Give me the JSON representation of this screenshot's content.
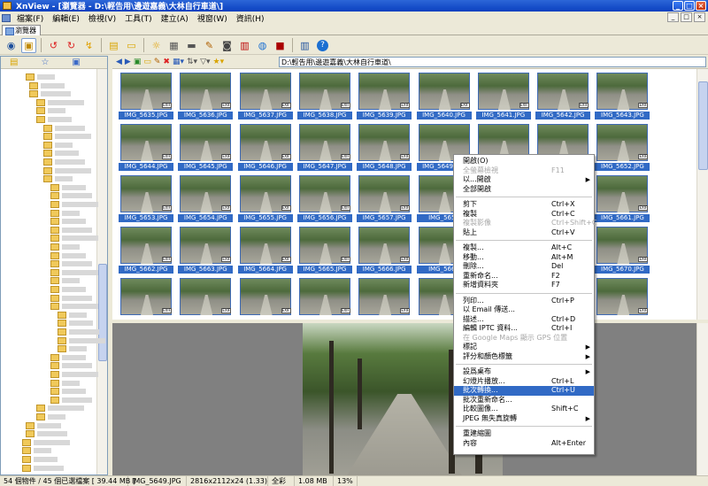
{
  "window": {
    "title": "XnView - [瀏覽器 - D:\\輕告用\\邊遊嘉義\\大林自行車道\\]",
    "buttons": [
      "_",
      "□",
      "×"
    ]
  },
  "menubar": {
    "items": [
      "檔案(F)",
      "編輯(E)",
      "檢視(V)",
      "工具(T)",
      "建立(A)",
      "視窗(W)",
      "資訊(H)"
    ]
  },
  "tabs": [
    {
      "label": "瀏覽器"
    }
  ],
  "toolbar": {
    "icons": [
      "eye-icon",
      "browser-icon",
      "rotate-left-icon",
      "rotate-right-icon",
      "refresh-icon",
      "open-icon",
      "folder-icon",
      "sun-icon",
      "print-icon",
      "scanner-icon",
      "edit-icon",
      "camera-icon",
      "filmstrip-icon",
      "web-icon",
      "stop-icon",
      "list-icon",
      "help-icon"
    ]
  },
  "address": {
    "path": "D:\\輕告用\\邊遊嘉義\\大林自行車道\\"
  },
  "thumbnails": [
    "IMG_5635.JPG",
    "IMG_5636.JPG",
    "IMG_5637.JPG",
    "IMG_5638.JPG",
    "IMG_5639.JPG",
    "IMG_5640.JPG",
    "IMG_5641.JPG",
    "IMG_5642.JPG",
    "IMG_5643.JPG",
    "IMG_5644.JPG",
    "IMG_5645.JPG",
    "IMG_5646.JPG",
    "IMG_5647.JPG",
    "IMG_5648.JPG",
    "IMG_5649.JPG",
    "",
    "",
    "IMG_5652.JPG",
    "IMG_5653.JPG",
    "IMG_5654.JPG",
    "IMG_5655.JPG",
    "IMG_5656.JPG",
    "IMG_5657.JPG",
    "IMG_5658",
    "",
    "",
    "IMG_5661.JPG",
    "IMG_5662.JPG",
    "IMG_5663.JPG",
    "IMG_5664.JPG",
    "IMG_5665.JPG",
    "IMG_5666.JPG",
    "IMG_5667",
    "",
    "",
    "IMG_5670.JPG",
    "",
    "",
    "",
    "",
    "",
    "",
    "",
    "",
    ""
  ],
  "exif_badge": "EXIF",
  "context_menu": [
    {
      "label": "開啟(O)",
      "shortcut": ""
    },
    {
      "label": "全螢幕檢視",
      "shortcut": "F11",
      "disabled": true
    },
    {
      "label": "以...開啟",
      "shortcut": "",
      "submenu": true
    },
    {
      "label": "全部開啟",
      "shortcut": ""
    },
    {
      "sep": true
    },
    {
      "label": "剪下",
      "shortcut": "Ctrl+X"
    },
    {
      "label": "複製",
      "shortcut": "Ctrl+C"
    },
    {
      "label": "複製影像",
      "shortcut": "Ctrl+Shift+C",
      "disabled": true
    },
    {
      "label": "貼上",
      "shortcut": "Ctrl+V"
    },
    {
      "sep": true
    },
    {
      "label": "複製...",
      "shortcut": "Alt+C"
    },
    {
      "label": "移動...",
      "shortcut": "Alt+M"
    },
    {
      "label": "刪除...",
      "shortcut": "Del"
    },
    {
      "label": "重新命名...",
      "shortcut": "F2"
    },
    {
      "label": "新增資料夾",
      "shortcut": "F7"
    },
    {
      "sep": true
    },
    {
      "label": "列印...",
      "shortcut": "Ctrl+P"
    },
    {
      "label": "以 Email 傳送...",
      "shortcut": ""
    },
    {
      "label": "描述...",
      "shortcut": "Ctrl+D"
    },
    {
      "label": "編輯 IPTC 資料...",
      "shortcut": "Ctrl+I"
    },
    {
      "label": "在 Google Maps 顯示 GPS 位置",
      "shortcut": "",
      "disabled": true
    },
    {
      "label": "標記",
      "shortcut": "",
      "submenu": true
    },
    {
      "label": "評分和顏色標籤",
      "shortcut": "",
      "submenu": true
    },
    {
      "sep": true
    },
    {
      "label": "設爲桌布",
      "shortcut": "",
      "submenu": true
    },
    {
      "label": "幻燈片播放...",
      "shortcut": "Ctrl+L"
    },
    {
      "label": "批次轉換...",
      "shortcut": "Ctrl+U",
      "highlighted": true
    },
    {
      "label": "批次重新命名...",
      "shortcut": ""
    },
    {
      "label": "比較圖像...",
      "shortcut": "Shift+C"
    },
    {
      "label": "JPEG 無失真旋轉",
      "shortcut": "",
      "submenu": true
    },
    {
      "sep": true
    },
    {
      "label": "重建縮圖",
      "shortcut": ""
    },
    {
      "label": "內容",
      "shortcut": "Alt+Enter"
    }
  ],
  "status": {
    "count": "54 個物件 / 45 個已選檔案 [ 39.44 MB ]",
    "filename": "IMG_5649.JPG",
    "dimensions": "2816x2112x24 (1.33)",
    "color": "全彩",
    "size": "1.08 MB",
    "zoom": "13%"
  }
}
